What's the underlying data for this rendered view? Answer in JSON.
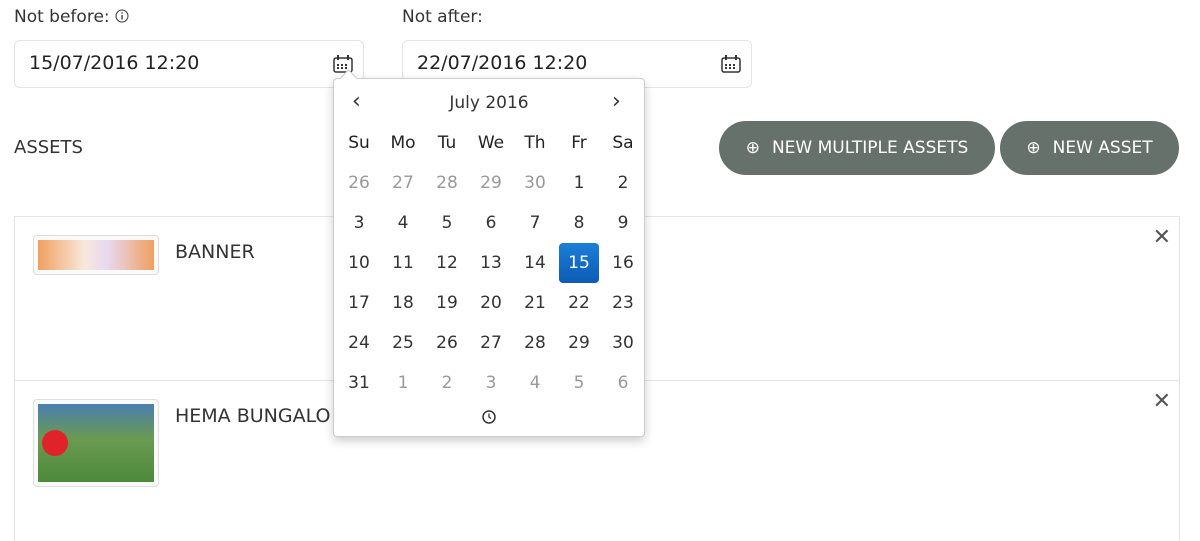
{
  "not_before": {
    "label": "Not before:",
    "value": "15/07/2016 12:20"
  },
  "not_after": {
    "label": "Not after:",
    "value": "22/07/2016 12:20"
  },
  "assets": {
    "title": "ASSETS",
    "new_multiple_label": "NEW MULTIPLE ASSETS",
    "new_asset_label": "NEW ASSET",
    "items": [
      {
        "name": "BANNER"
      },
      {
        "name": "HEMA BUNGALO"
      }
    ]
  },
  "colors": {
    "button": "#67716c",
    "selected": "#1a6fc9"
  },
  "datepicker": {
    "month": "July 2016",
    "prev": "‹",
    "next": "›",
    "weekdays": [
      "Su",
      "Mo",
      "Tu",
      "We",
      "Th",
      "Fr",
      "Sa"
    ],
    "days": [
      [
        "26",
        "27",
        "28",
        "29",
        "30",
        "1",
        "2"
      ],
      [
        "3",
        "4",
        "5",
        "6",
        "7",
        "8",
        "9"
      ],
      [
        "10",
        "11",
        "12",
        "13",
        "14",
        "15",
        "16"
      ],
      [
        "17",
        "18",
        "19",
        "20",
        "21",
        "22",
        "23"
      ],
      [
        "24",
        "25",
        "26",
        "27",
        "28",
        "29",
        "30"
      ],
      [
        "31",
        "1",
        "2",
        "3",
        "4",
        "5",
        "6"
      ]
    ],
    "selected": "15"
  }
}
